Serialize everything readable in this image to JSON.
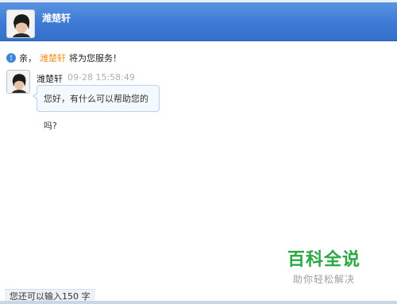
{
  "header": {
    "agent_name": "潍楚轩",
    "avatar_icon": "person-avatar-icon",
    "background_color": "#3f7bd6"
  },
  "notice": {
    "icon": "info-icon",
    "prefix": "亲，",
    "agent_name": "潍楚轩",
    "suffix": "将为您服务！",
    "agent_color": "#f08c16"
  },
  "messages": [
    {
      "sender": "潍楚轩",
      "time": "09-28 15:58:49",
      "text": "您好，有什么可以帮助您的吗?"
    }
  ],
  "watermark": {
    "title": "百科全说",
    "subtitle": "助你轻松解决"
  },
  "input": {
    "remaining_text": "您还可以输入150 字"
  }
}
